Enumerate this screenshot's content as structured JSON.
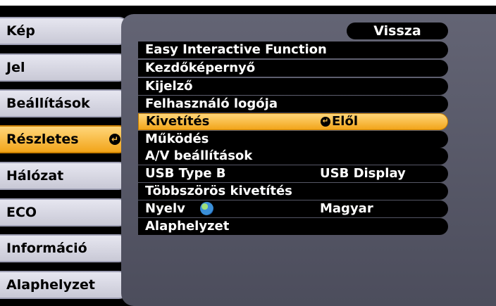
{
  "sidebar": {
    "tabs": [
      {
        "label": "Kép"
      },
      {
        "label": "Jel"
      },
      {
        "label": "Beállítások"
      },
      {
        "label": "Részletes"
      },
      {
        "label": "Hálózat"
      },
      {
        "label": "ECO"
      },
      {
        "label": "Információ"
      },
      {
        "label": "Alaphelyzet"
      }
    ],
    "active_index": 3
  },
  "submenu": {
    "back_label": "Vissza",
    "items": [
      {
        "label": "Easy Interactive Function",
        "value": ""
      },
      {
        "label": "Kezdőképernyő",
        "value": ""
      },
      {
        "label": "Kijelző",
        "value": ""
      },
      {
        "label": "Felhasználó logója",
        "value": ""
      },
      {
        "label": "Kivetítés",
        "value": "Elől"
      },
      {
        "label": "Működés",
        "value": ""
      },
      {
        "label": "A/V beállítások",
        "value": ""
      },
      {
        "label": "USB Type B",
        "value": "USB Display"
      },
      {
        "label": "Többszörös kivetítés",
        "value": ""
      },
      {
        "label": "Nyelv",
        "value": "Magyar"
      },
      {
        "label": "Alaphelyzet",
        "value": ""
      }
    ],
    "selected_index": 4
  },
  "icons": {
    "enter": "enter-arrow-icon",
    "language": "globe-icon"
  },
  "colors": {
    "highlight": "#f2a51a",
    "tab_inactive": "#d8d8e2",
    "submenu_bg": "#58596a"
  }
}
